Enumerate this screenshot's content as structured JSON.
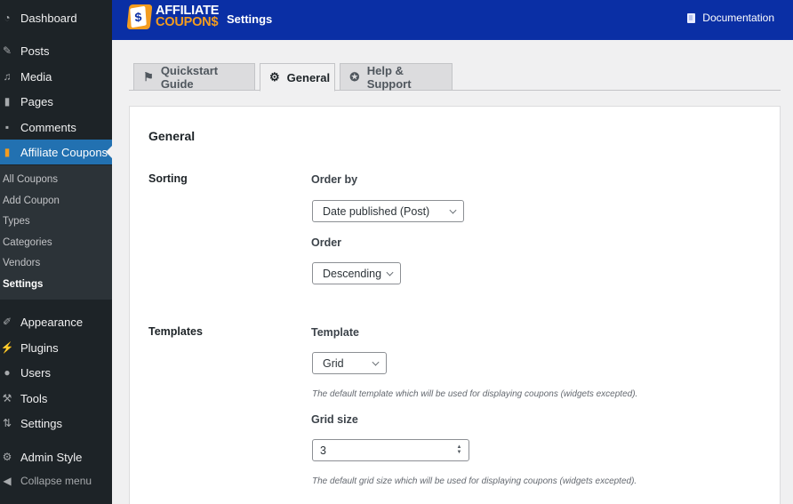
{
  "sidebar": {
    "items": [
      {
        "label": "Dashboard",
        "icon": "dashboard-icon"
      },
      {
        "label": "Posts",
        "icon": "pin-icon"
      },
      {
        "label": "Media",
        "icon": "media-icon"
      },
      {
        "label": "Pages",
        "icon": "pages-icon"
      },
      {
        "label": "Comments",
        "icon": "comment-icon"
      },
      {
        "label": "Affiliate Coupons",
        "icon": "coupon-icon",
        "active": true
      }
    ],
    "submenu": [
      {
        "label": "All Coupons"
      },
      {
        "label": "Add Coupon"
      },
      {
        "label": "Types"
      },
      {
        "label": "Categories"
      },
      {
        "label": "Vendors"
      },
      {
        "label": "Settings",
        "current": true
      }
    ],
    "items_bottom": [
      {
        "label": "Appearance",
        "icon": "paintbrush-icon"
      },
      {
        "label": "Plugins",
        "icon": "plugin-icon"
      },
      {
        "label": "Users",
        "icon": "user-icon"
      },
      {
        "label": "Tools",
        "icon": "wrench-icon"
      },
      {
        "label": "Settings",
        "icon": "settings-sliders-icon"
      },
      {
        "label": "Admin Style",
        "icon": "gear-icon"
      },
      {
        "label": "Collapse menu",
        "icon": "collapse-icon"
      }
    ]
  },
  "header": {
    "logo_line1": "AFFILIATE",
    "logo_line2": "COUPON$",
    "logo_glyph": "$",
    "title": "Settings",
    "documentation_label": "Documentation",
    "brand_color": "#0a2fa5",
    "accent_color": "#f39c1f"
  },
  "tabs": [
    {
      "label": "Quickstart Guide",
      "icon": "graduation-cap-icon"
    },
    {
      "label": "General",
      "icon": "gear-icon",
      "active": true
    },
    {
      "label": "Help & Support",
      "icon": "lifebuoy-icon"
    }
  ],
  "card": {
    "title": "General",
    "sorting": {
      "label": "Sorting",
      "order_by_label": "Order by",
      "order_by_value": "Date published (Post)",
      "order_label": "Order",
      "order_value": "Descending"
    },
    "templates": {
      "label": "Templates",
      "template_label": "Template",
      "template_value": "Grid",
      "template_desc": "The default template which will be used for displaying coupons (widgets excepted).",
      "grid_size_label": "Grid size",
      "grid_size_value": "3",
      "grid_size_desc": "The default grid size which will be used for displaying coupons (widgets excepted)."
    }
  }
}
